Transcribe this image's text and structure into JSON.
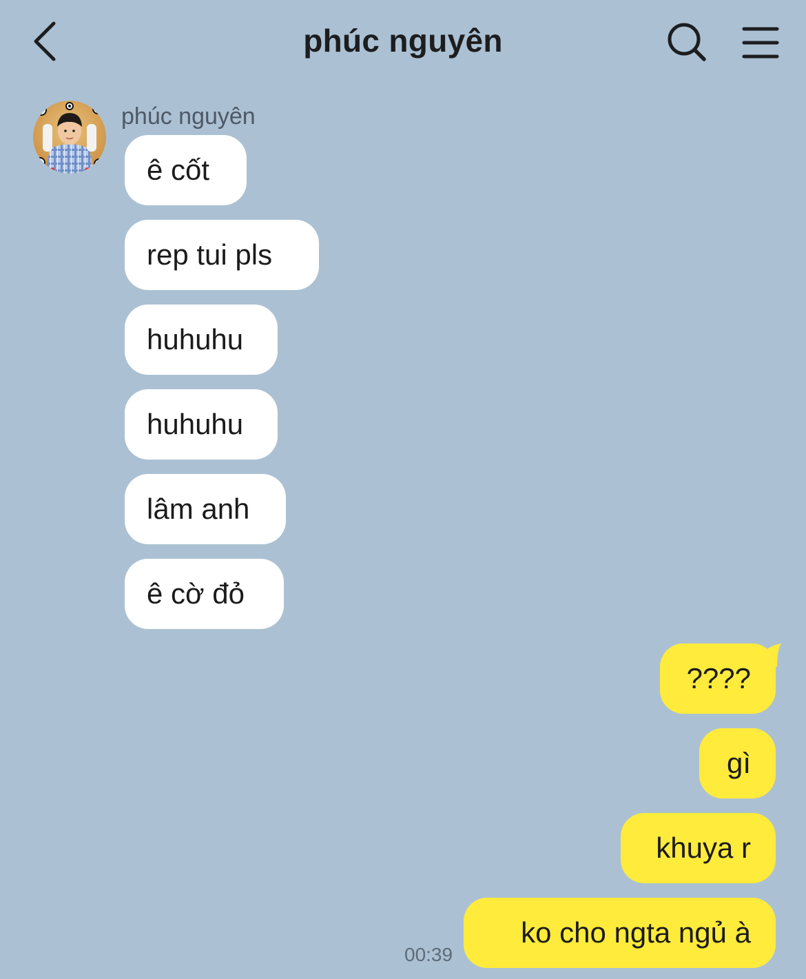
{
  "header": {
    "title": "phúc nguyên"
  },
  "sender": {
    "name": "phúc nguyên"
  },
  "incoming_messages": [
    {
      "text": "ê cốt"
    },
    {
      "text": "rep tui pls"
    },
    {
      "text": "huhuhu"
    },
    {
      "text": "huhuhu"
    },
    {
      "text": "lâm anh"
    },
    {
      "text": "ê cờ đỏ"
    }
  ],
  "outgoing_messages": [
    {
      "text": "????"
    },
    {
      "text": "gì"
    },
    {
      "text": "khuya r"
    },
    {
      "text": "ko cho ngta ngủ à"
    }
  ],
  "last_timestamp": "00:39",
  "colors": {
    "background": "#abc1d3",
    "incoming_bubble": "#ffffff",
    "outgoing_bubble": "#ffeb3b",
    "text": "#1b1b1b"
  },
  "icons": {
    "back": "chevron-left-icon",
    "search": "search-icon",
    "menu": "hamburger-menu-icon"
  }
}
